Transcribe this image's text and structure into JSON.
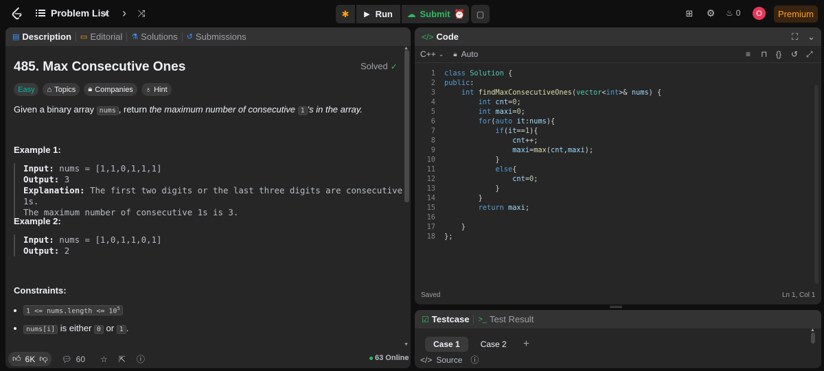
{
  "topbar": {
    "problem_list_label": "Problem List",
    "run_label": "Run",
    "submit_label": "Submit",
    "streak_count": "0",
    "avatar_letter": "O",
    "premium_label": "Premium"
  },
  "left": {
    "tabs": [
      "Description",
      "Editorial",
      "Solutions",
      "Submissions"
    ],
    "title": "485. Max Consecutive Ones",
    "solved_label": "Solved",
    "chips": [
      "Easy",
      "Topics",
      "Companies",
      "Hint"
    ],
    "statement": {
      "pre": "Given a binary array ",
      "code1": "nums",
      "mid": ", return ",
      "em1": "the maximum number of consecutive ",
      "code2": "1",
      "em2": "'s in the array."
    },
    "examples": [
      {
        "heading": "Example 1:",
        "input_label": "Input:",
        "input_value": "nums = [1,1,0,1,1,1]",
        "output_label": "Output:",
        "output_value": "3",
        "explanation_label": "Explanation:",
        "explanation_line1": "The first two digits or the last three digits are consecutive 1s.",
        "explanation_line2": "The maximum number of consecutive 1s is 3."
      },
      {
        "heading": "Example 2:",
        "input_label": "Input:",
        "input_value": "nums = [1,0,1,1,0,1]",
        "output_label": "Output:",
        "output_value": "2"
      }
    ],
    "constraints_heading": "Constraints:",
    "constraint1_code": "1 <= nums.length <= 10",
    "constraint1_sup": "5",
    "constraint2_code1": "nums[i]",
    "constraint2_text1": " is either ",
    "constraint2_code2": "0",
    "constraint2_text2": " or ",
    "constraint2_code3": "1",
    "constraint2_text3": ".",
    "footer": {
      "likes": "6K",
      "comments": "60",
      "online": "63 Online"
    }
  },
  "code": {
    "header": "Code",
    "language": "C++",
    "mode": "Auto",
    "saved_label": "Saved",
    "cursor_pos": "Ln 1, Col 1",
    "line_numbers": [
      "1",
      "2",
      "3",
      "4",
      "5",
      "6",
      "7",
      "8",
      "9",
      "10",
      "11",
      "12",
      "13",
      "14",
      "15",
      "16",
      "17",
      "18"
    ]
  },
  "test": {
    "tabs": [
      "Testcase",
      "Test Result"
    ],
    "cases": [
      "Case 1",
      "Case 2"
    ],
    "add_label": "+",
    "source_label": "Source"
  },
  "colors": {
    "accent_orange": "#ffa116",
    "easy_teal": "#00b8a3",
    "submit_green": "#2cbb5d",
    "panel_bg": "#262626"
  }
}
